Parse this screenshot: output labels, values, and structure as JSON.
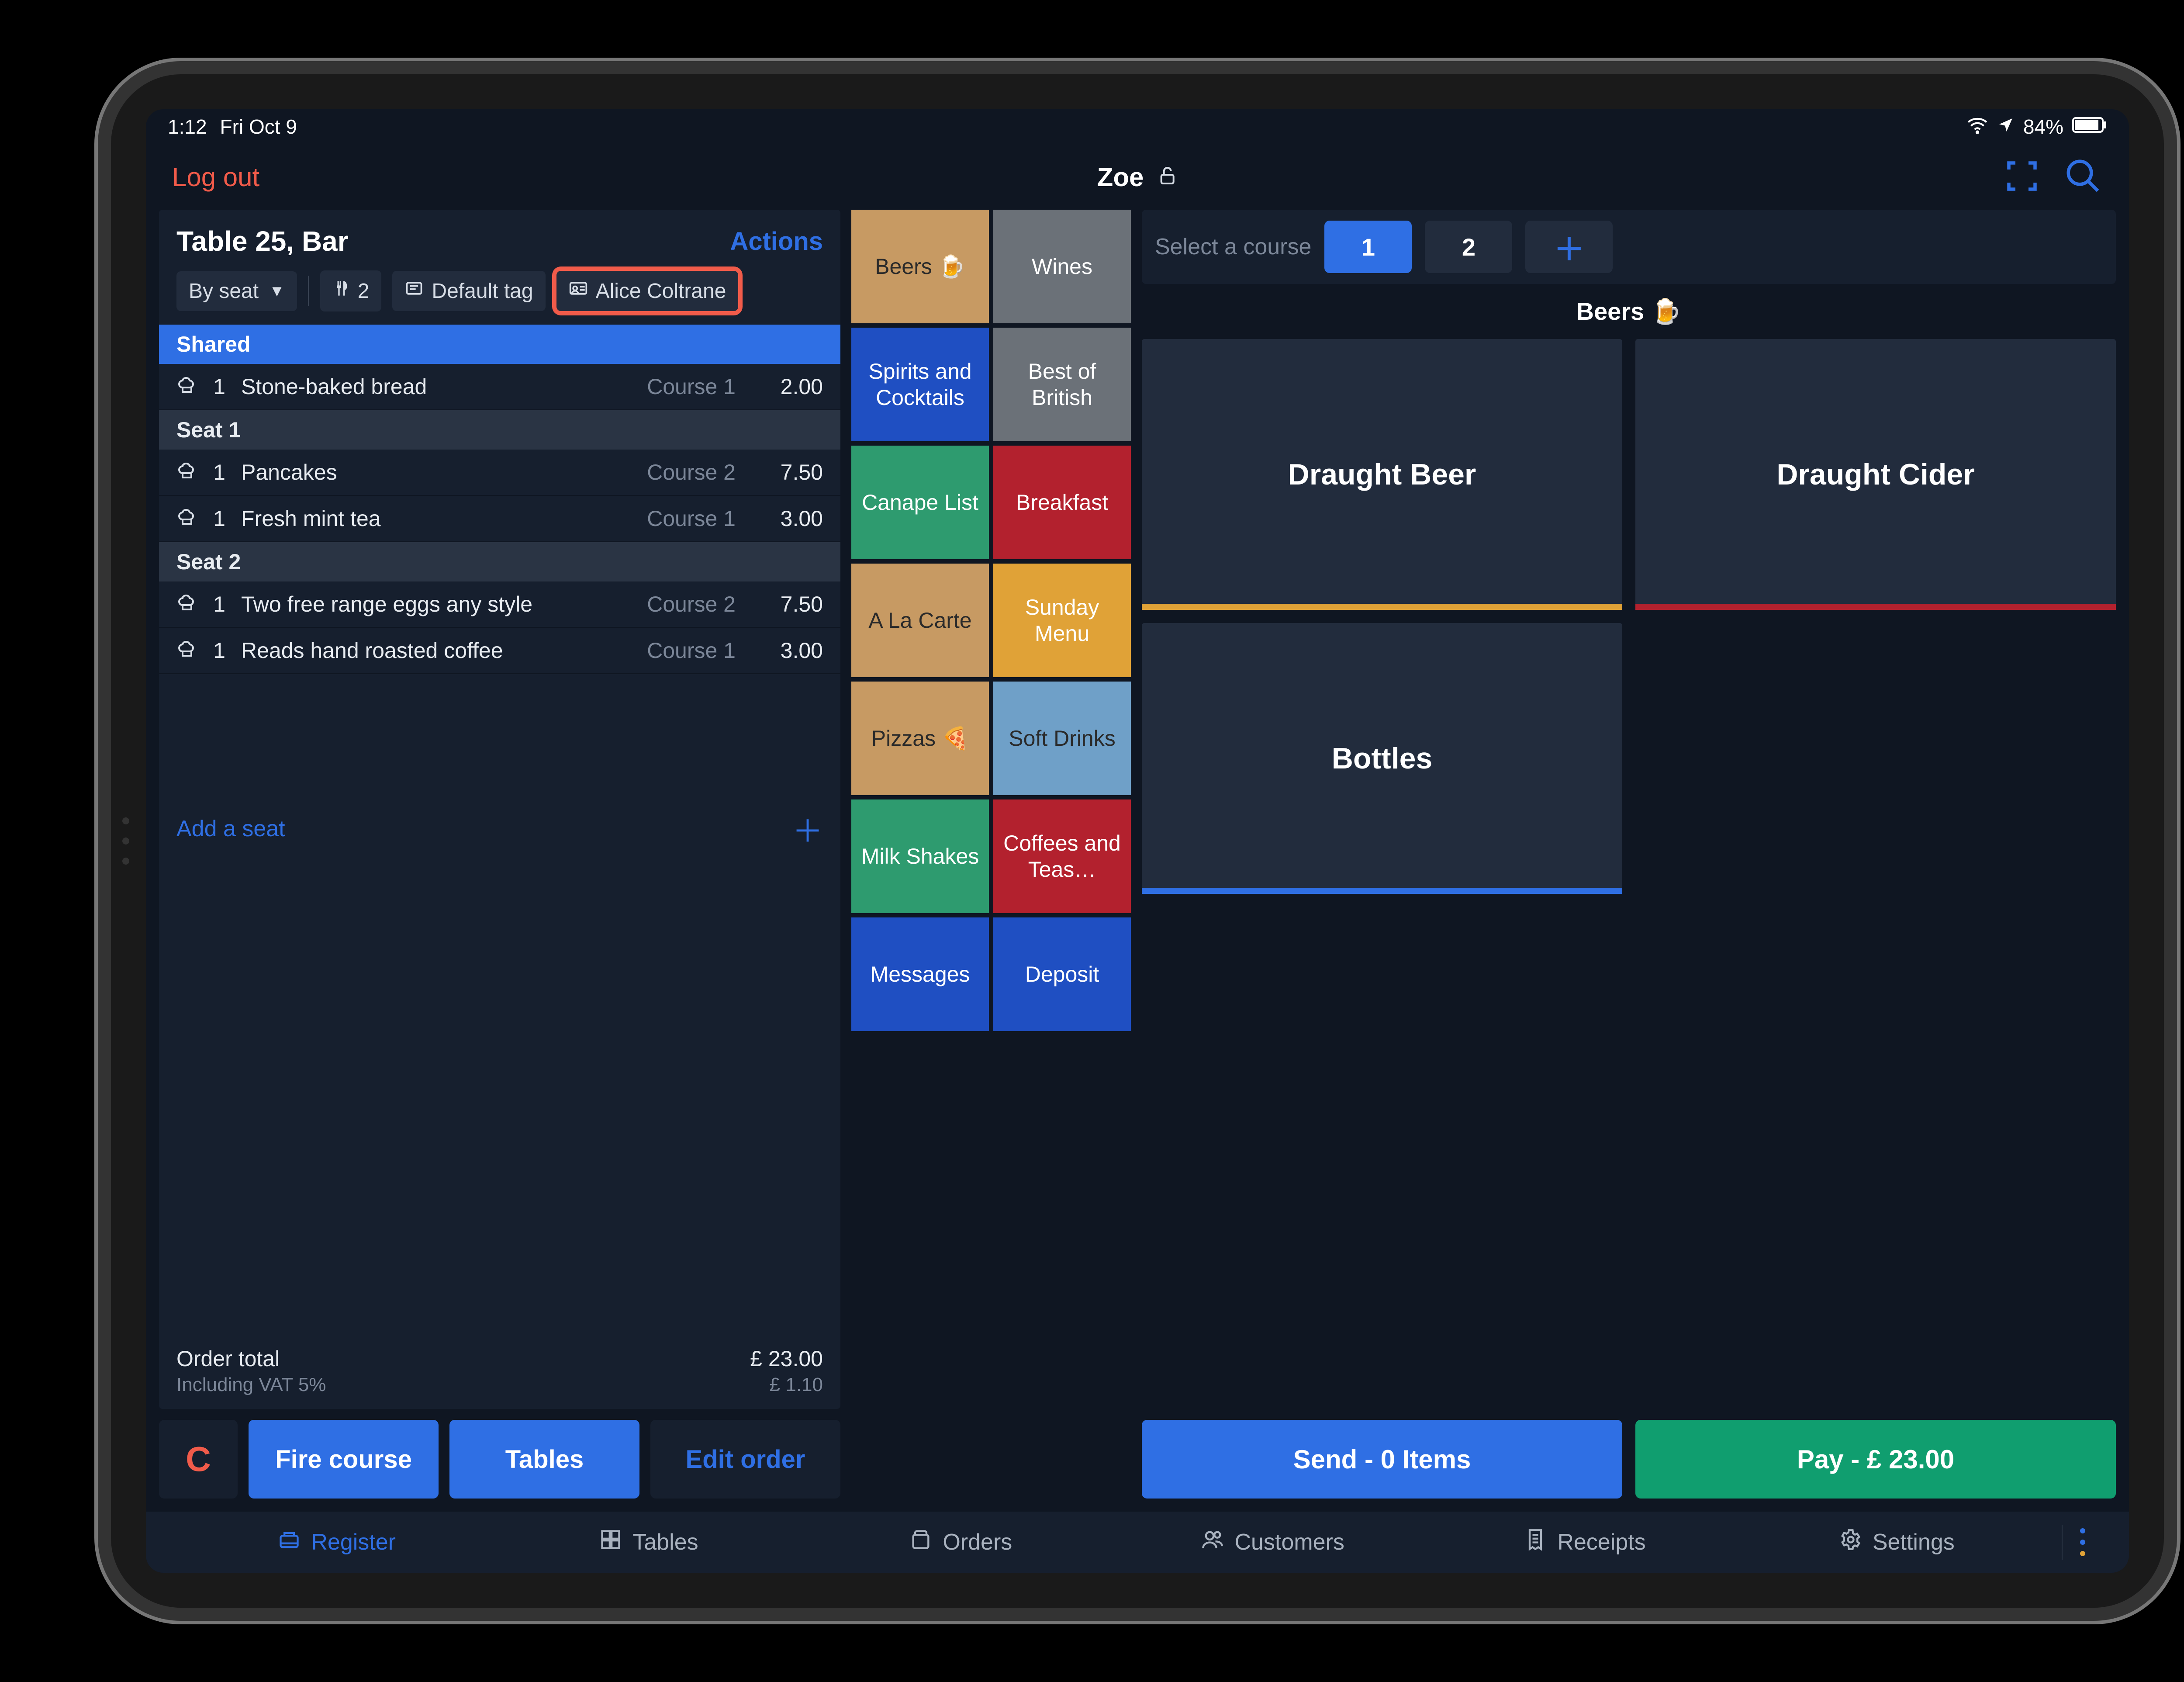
{
  "status": {
    "time": "1:12",
    "date": "Fri Oct 9",
    "battery": "84%"
  },
  "appbar": {
    "logout": "Log out",
    "user": "Zoe"
  },
  "order": {
    "title": "Table 25, Bar",
    "actions": "Actions",
    "chips": {
      "byseat": "By seat",
      "covers": "2",
      "tag": "Default tag",
      "customer": "Alice Coltrane"
    },
    "seats": [
      {
        "label": "Shared",
        "style": "blue",
        "lines": [
          {
            "qty": "1",
            "name": "Stone-baked bread",
            "course": "Course 1",
            "price": "2.00"
          }
        ]
      },
      {
        "label": "Seat 1",
        "style": "gray",
        "lines": [
          {
            "qty": "1",
            "name": "Pancakes",
            "course": "Course 2",
            "price": "7.50"
          },
          {
            "qty": "1",
            "name": "Fresh mint tea",
            "course": "Course 1",
            "price": "3.00"
          }
        ]
      },
      {
        "label": "Seat 2",
        "style": "gray",
        "lines": [
          {
            "qty": "1",
            "name": "Two free range eggs any style",
            "course": "Course 2",
            "price": "7.50"
          },
          {
            "qty": "1",
            "name": "Reads hand roasted coffee",
            "course": "Course 1",
            "price": "3.00"
          }
        ]
      }
    ],
    "add_seat": "Add a seat",
    "totals": {
      "label": "Order total",
      "amount": "£ 23.00",
      "sub_label": "Including VAT 5%",
      "sub_amount": "£ 1.10"
    },
    "buttons": {
      "cancel": "C",
      "fire": "Fire course",
      "tables": "Tables",
      "edit": "Edit order"
    }
  },
  "categories": [
    {
      "label": "Beers 🍺",
      "bg": "#c79a63",
      "dark": true
    },
    {
      "label": "Wines",
      "bg": "#6b7178"
    },
    {
      "label": "Spirits and Cocktails",
      "bg": "#1f4fc2"
    },
    {
      "label": "Best of British",
      "bg": "#6b7178"
    },
    {
      "label": "Canape List",
      "bg": "#2e9b6f"
    },
    {
      "label": "Breakfast",
      "bg": "#b3212e"
    },
    {
      "label": "A La Carte",
      "bg": "#c79a63",
      "dark": true
    },
    {
      "label": "Sunday Menu",
      "bg": "#e0a237"
    },
    {
      "label": "Pizzas 🍕",
      "bg": "#c79a63",
      "dark": true
    },
    {
      "label": "Soft Drinks",
      "bg": "#6fa0c8",
      "dark": true
    },
    {
      "label": "Milk Shakes",
      "bg": "#2e9b6f"
    },
    {
      "label": "Coffees and Teas…",
      "bg": "#b3212e"
    },
    {
      "label": "Messages",
      "bg": "#1f4fc2"
    },
    {
      "label": "Deposit",
      "bg": "#1f4fc2"
    }
  ],
  "courses": {
    "label": "Select a course",
    "buttons": [
      "1",
      "2"
    ]
  },
  "subcat_title": "Beers 🍺",
  "subcats": [
    {
      "label": "Draught Beer",
      "underline": "#e0a237"
    },
    {
      "label": "Draught Cider",
      "underline": "#b3212e"
    },
    {
      "label": "Bottles",
      "underline": "#2f6fe4"
    }
  ],
  "pay": {
    "send": "Send - 0 Items",
    "pay": "Pay - £ 23.00"
  },
  "nav": {
    "items": [
      {
        "label": "Register",
        "active": true
      },
      {
        "label": "Tables"
      },
      {
        "label": "Orders"
      },
      {
        "label": "Customers"
      },
      {
        "label": "Receipts"
      },
      {
        "label": "Settings"
      }
    ]
  }
}
